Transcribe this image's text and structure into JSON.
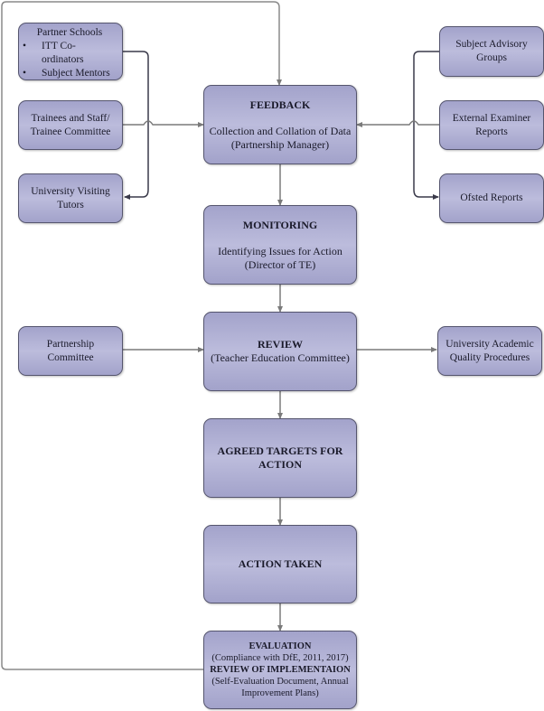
{
  "diagram": {
    "center": {
      "feedback": {
        "title": "FEEDBACK",
        "line1": "Collection and Collation of Data",
        "line2": "(Partnership Manager)"
      },
      "monitoring": {
        "title": "MONITORING",
        "line1": "Identifying Issues for Action",
        "line2": "(Director of TE)"
      },
      "review": {
        "title": "REVIEW",
        "line1": "(Teacher Education Committee)"
      },
      "targets": {
        "title_line1": "AGREED TARGETS FOR",
        "title_line2": "ACTION"
      },
      "action": {
        "title": "ACTION TAKEN"
      },
      "evaluation": {
        "title": "EVALUATION",
        "line1": "(Compliance with DfE, 2011, 2017)",
        "title2": "REVIEW OF IMPLEMENTAION",
        "line2": "(Self-Evaluation Document, Annual",
        "line3": "Improvement Plans)"
      }
    },
    "left": {
      "partner_schools": {
        "heading": "Partner Schools",
        "bullets": [
          "ITT Co-",
          "ordinators",
          "Subject Mentors"
        ]
      },
      "trainees": {
        "line1": "Trainees and Staff/",
        "line2": "Trainee Committee"
      },
      "tutors": {
        "line1": "University Visiting",
        "line2": "Tutors"
      },
      "partnership_committee": {
        "line1": "Partnership",
        "line2": "Committee"
      }
    },
    "right": {
      "advisory": {
        "line1": "Subject Advisory",
        "line2": "Groups"
      },
      "examiner": {
        "line1": "External Examiner",
        "line2": "Reports"
      },
      "ofsted": {
        "line1": "Ofsted Reports"
      },
      "quality": {
        "line1": "University Academic",
        "line2": "Quality Procedures"
      }
    },
    "colors": {
      "box_fill": "#b3b3d8",
      "box_border": "#55556e",
      "line": "#7a7a7a",
      "line_dark": "#3a3a4a"
    }
  }
}
